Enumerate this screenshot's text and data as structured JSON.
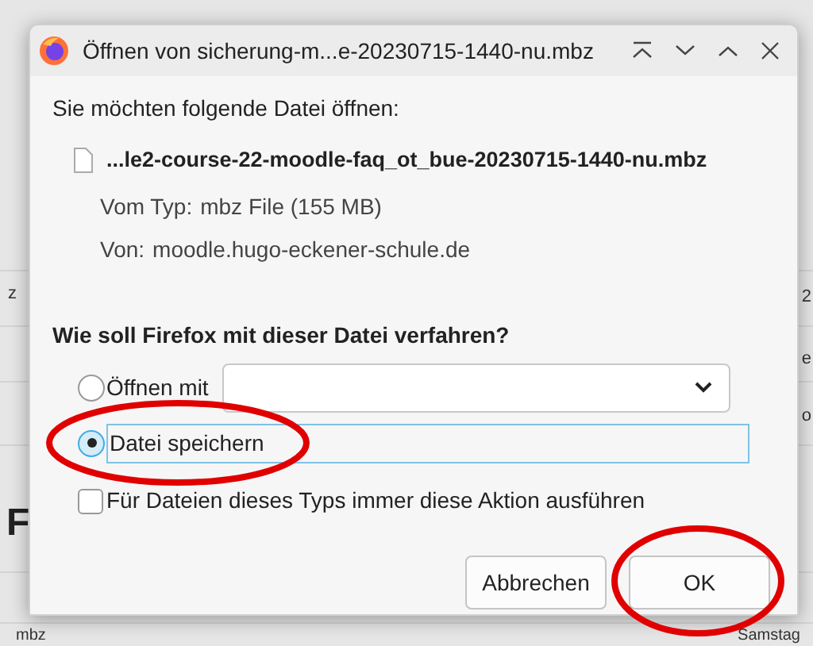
{
  "background_page": {
    "fragments": [
      {
        "kind": "small",
        "text": "z"
      },
      {
        "kind": "small",
        "text": "2"
      },
      {
        "kind": "small",
        "text": "e"
      },
      {
        "kind": "small",
        "text": "o"
      },
      {
        "kind": "heading",
        "text": "F"
      },
      {
        "kind": "footer-left",
        "text": "mbz"
      },
      {
        "kind": "footer-right",
        "text": "Samstag"
      }
    ]
  },
  "window": {
    "title": "Öffnen von sicherung-m...e-20230715-1440-nu.mbz"
  },
  "intro": "Sie möchten folgende Datei öffnen:",
  "file": {
    "name": "...le2-course-22-moodle-faq_ot_bue-20230715-1440-nu.mbz",
    "type_label": "Vom Typ:",
    "type_value": "mbz File (155 MB)",
    "from_label": "Von:",
    "from_value": "moodle.hugo-eckener-schule.de"
  },
  "question": "Wie soll Firefox mit dieser Datei verfahren?",
  "options": [
    {
      "kind": "open-with",
      "label": "Öffnen mit",
      "selected": false,
      "highlighted": false
    },
    {
      "kind": "save",
      "label": "Datei speichern",
      "selected": true,
      "highlighted": true
    }
  ],
  "remember": {
    "label": "Für Dateien dieses Typs immer diese Aktion ausführen",
    "checked": false
  },
  "buttons": [
    {
      "label": "Abbrechen",
      "highlighted": false
    },
    {
      "label": "OK",
      "highlighted": true
    }
  ]
}
